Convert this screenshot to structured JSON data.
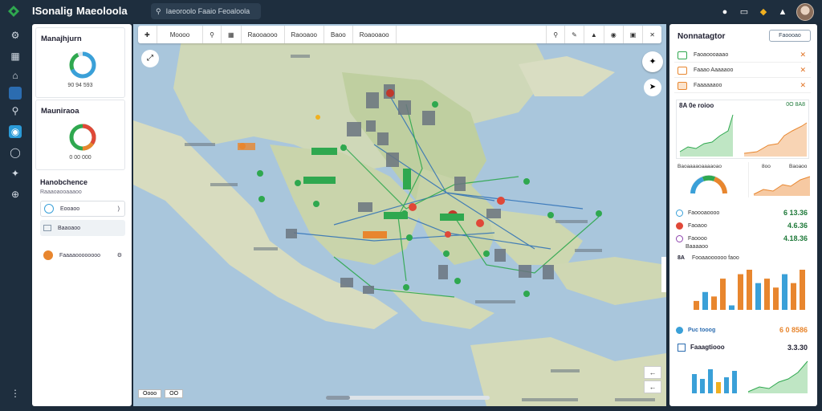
{
  "topbar": {
    "title": "ISonalig",
    "subtitle": "Maeoloola",
    "search_text": "Iaeoroolo Faaio Feoaloola",
    "icons": [
      "bell-icon",
      "calendar-icon",
      "alert-icon"
    ]
  },
  "left": {
    "card1_title": "Manajhjurn",
    "card1_value": "90 94 593",
    "card2_title": "Mauniraoa",
    "card2_value": "0 00 000",
    "section_title": "Hanobchence",
    "section_sub": "Raaaoaooaaaoo",
    "items": [
      "Eooaoo",
      "Baaoaoo",
      "Faaaaoooooooo"
    ]
  },
  "map": {
    "toolbar": [
      "Moooo",
      "Raooaooo",
      "Raooaoo",
      "Baoo",
      "Roaooaoo"
    ],
    "scale_left": "Oooo",
    "scale_right": "OO"
  },
  "right": {
    "title": "Nonnatagtor",
    "button": "Faoooao",
    "rows": [
      "Faoaoooaaao",
      "Faaao Aaaaaoo",
      "Faaaaaaoo"
    ],
    "chart1_title": "8A 0e roioo",
    "chart1_legend": "0O 8A8",
    "gauge_title": "Baoaaaaoaaaaoao",
    "gauge_sub": "8oo",
    "gauge_sub2": "Baoaoo",
    "metrics": [
      {
        "label": "Faoooaoooo",
        "value": "6 13.36"
      },
      {
        "label": "Faoaoo",
        "value": "4.6.36"
      },
      {
        "label": "Faoooo",
        "value": "4.18.36"
      },
      {
        "label": "Baaaaoo",
        "value": ""
      }
    ],
    "bar_title": "Fooaaoooooo faoo",
    "bar_label": "8A",
    "bar_values": [
      2,
      4,
      3,
      7,
      1,
      8,
      9,
      6,
      7,
      5,
      8,
      6,
      9
    ],
    "line_title": "Puc tooog",
    "line_value": "6 0 8586",
    "line2_title": "Faaagtiooo",
    "line2_value": "3.3.30"
  },
  "colors": {
    "accent_green": "#2fa84f",
    "accent_orange": "#e8862e",
    "dark": "#1e2e3e"
  }
}
